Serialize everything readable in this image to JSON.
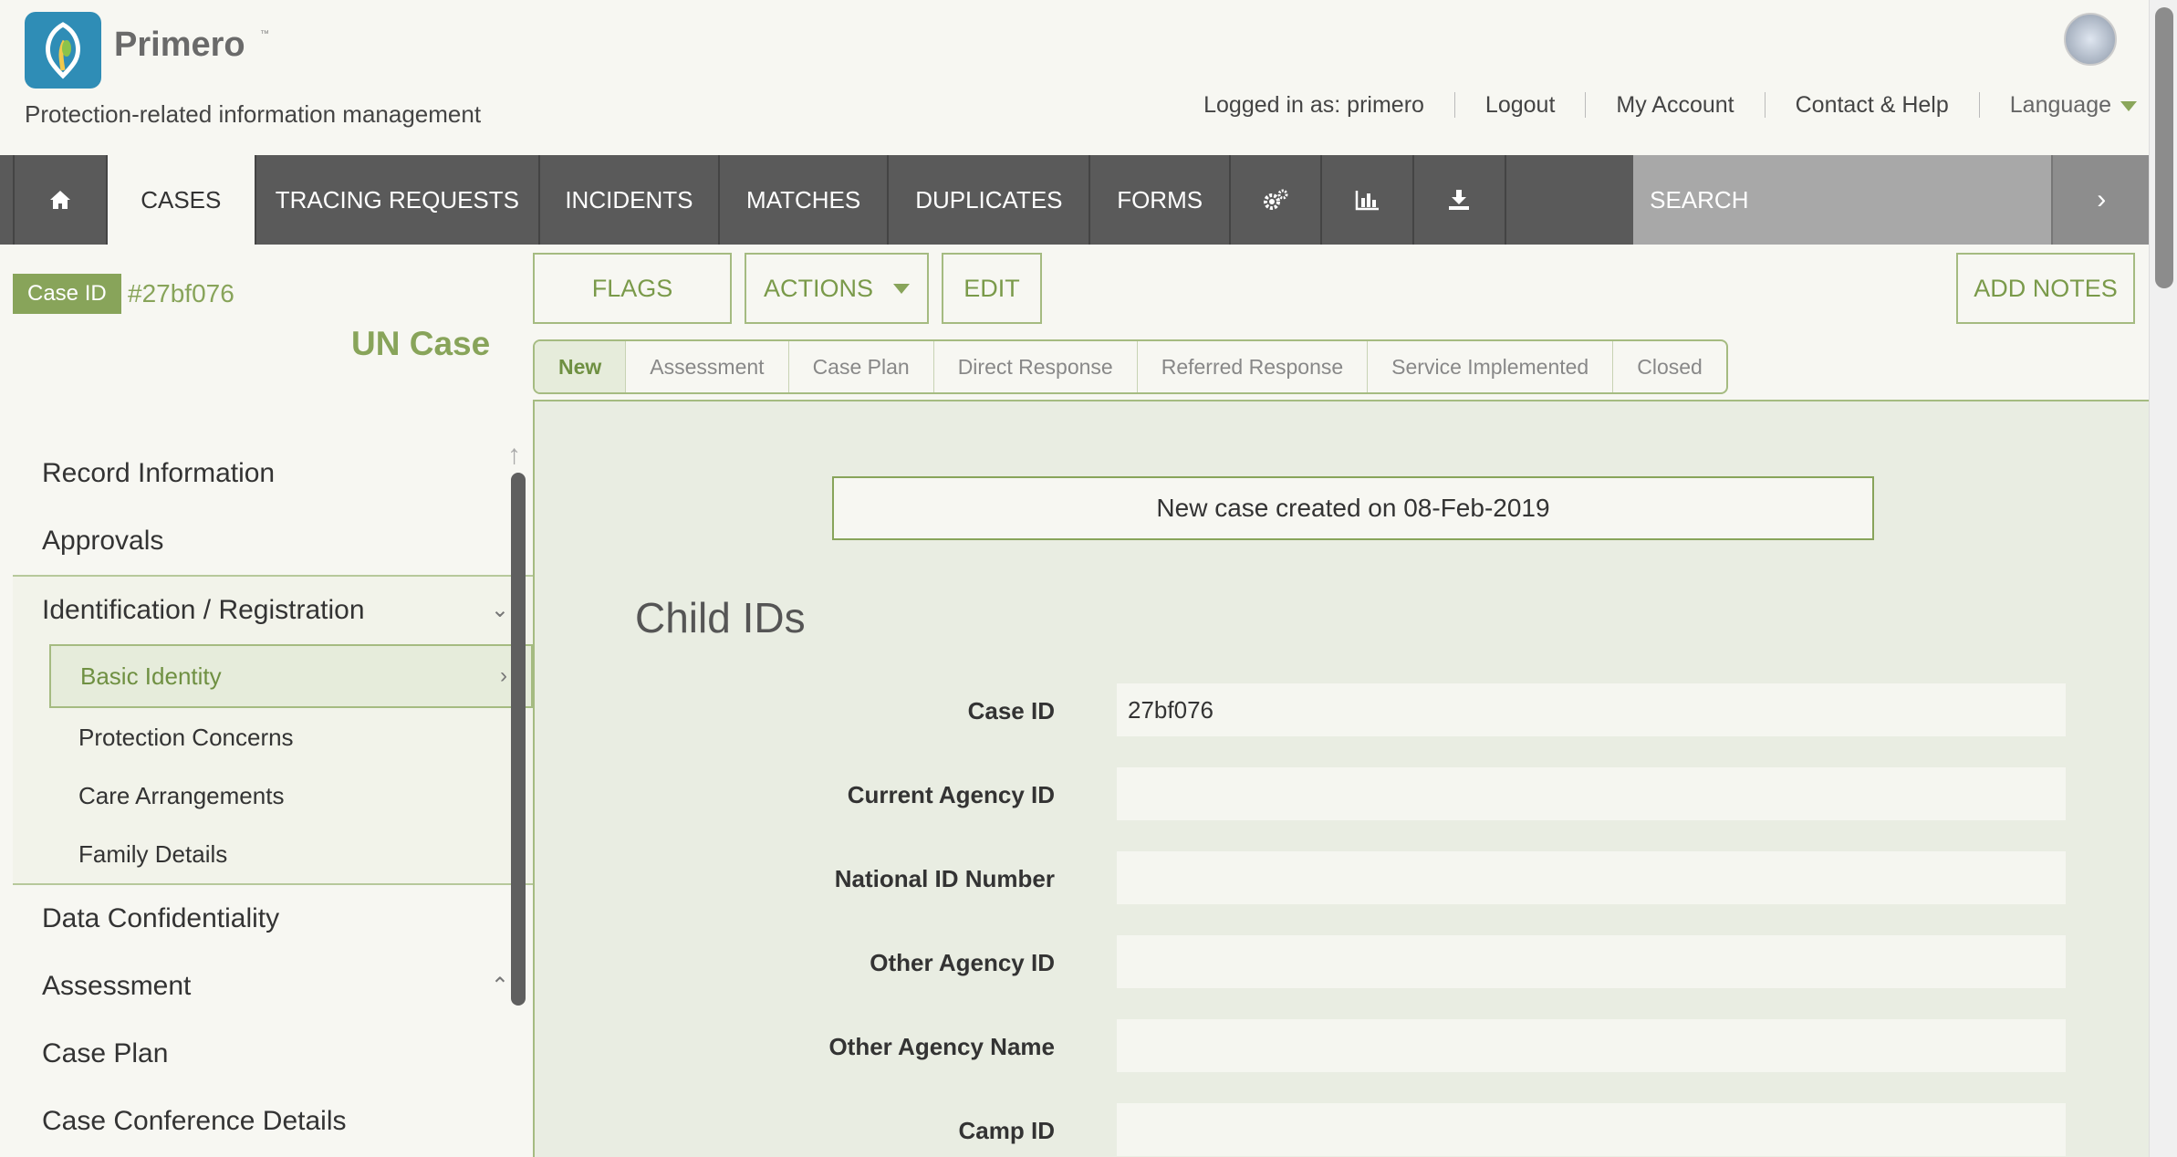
{
  "header": {
    "app_name": "Primero",
    "tm": "™",
    "tagline": "Protection-related information management",
    "logged_in": "Logged in as: primero",
    "logout": "Logout",
    "my_account": "My Account",
    "contact_help": "Contact & Help",
    "language": "Language"
  },
  "nav": {
    "cases": "CASES",
    "tracing": "TRACING REQUESTS",
    "incidents": "INCIDENTS",
    "matches": "MATCHES",
    "duplicates": "DUPLICATES",
    "forms": "FORMS",
    "search_placeholder": "SEARCH"
  },
  "record": {
    "case_id_label": "Case ID",
    "case_id_value": "#27bf076",
    "case_type": "UN Case"
  },
  "buttons": {
    "flags": "FLAGS",
    "actions": "ACTIONS",
    "edit": "EDIT",
    "add_notes": "ADD NOTES"
  },
  "workflow": [
    "New",
    "Assessment",
    "Case Plan",
    "Direct Response",
    "Referred Response",
    "Service Implemented",
    "Closed"
  ],
  "sidebar": {
    "record_info": "Record Information",
    "approvals": "Approvals",
    "identification": "Identification / Registration",
    "basic_identity": "Basic Identity",
    "protection": "Protection Concerns",
    "care": "Care Arrangements",
    "family": "Family Details",
    "data_conf": "Data Confidentiality",
    "assessment": "Assessment",
    "case_plan": "Case Plan",
    "case_conf": "Case Conference Details"
  },
  "main": {
    "notice": "New case created on 08-Feb-2019",
    "section_title": "Child IDs",
    "fields": [
      {
        "label": "Case ID",
        "value": "27bf076"
      },
      {
        "label": "Current Agency ID",
        "value": ""
      },
      {
        "label": "National ID Number",
        "value": ""
      },
      {
        "label": "Other Agency ID",
        "value": ""
      },
      {
        "label": "Other Agency Name",
        "value": ""
      },
      {
        "label": "Camp ID",
        "value": ""
      }
    ]
  },
  "colors": {
    "accent": "#88a45a",
    "nav_bg": "#5a5a5a",
    "logo_blue": "#2f8db6"
  }
}
